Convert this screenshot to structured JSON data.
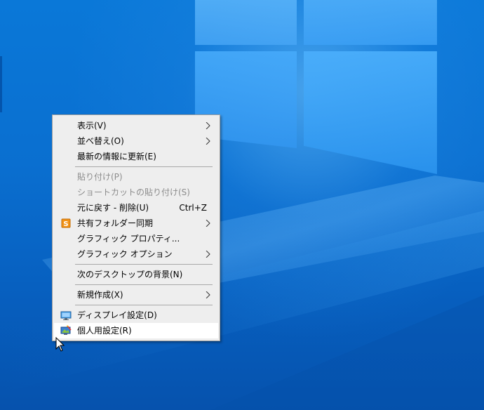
{
  "desktop": {
    "background_color": "#0a6fd0",
    "logo_color": "#5ab4fa"
  },
  "context_menu": {
    "items": [
      {
        "label": "表示(V)",
        "submenu": true,
        "enabled": true
      },
      {
        "label": "並べ替え(O)",
        "submenu": true,
        "enabled": true
      },
      {
        "label": "最新の情報に更新(E)",
        "submenu": false,
        "enabled": true
      },
      {
        "label": "貼り付け(P)",
        "submenu": false,
        "enabled": false
      },
      {
        "label": "ショートカットの貼り付け(S)",
        "submenu": false,
        "enabled": false
      },
      {
        "label": "元に戻す - 削除(U)",
        "shortcut": "Ctrl+Z",
        "submenu": false,
        "enabled": true
      },
      {
        "label": "共有フォルダー同期",
        "icon": "sync-app-icon",
        "icon_glyph": "S",
        "submenu": true,
        "enabled": true
      },
      {
        "label": "グラフィック プロパティ...",
        "submenu": false,
        "enabled": true
      },
      {
        "label": "グラフィック オプション",
        "submenu": true,
        "enabled": true
      },
      {
        "label": "次のデスクトップの背景(N)",
        "submenu": false,
        "enabled": true
      },
      {
        "label": "新規作成(X)",
        "submenu": true,
        "enabled": true
      },
      {
        "label": "ディスプレイ設定(D)",
        "icon": "display-settings-icon",
        "submenu": false,
        "enabled": true
      },
      {
        "label": "個人用設定(R)",
        "icon": "personalize-icon",
        "submenu": false,
        "enabled": true,
        "highlighted": true
      }
    ],
    "colors": {
      "background": "#eeeeee",
      "highlight": "#ffffff",
      "disabled_text": "#8c8c8c",
      "separator": "#a8a8a8"
    }
  },
  "cursor": {
    "icon": "mouse-pointer-icon"
  }
}
